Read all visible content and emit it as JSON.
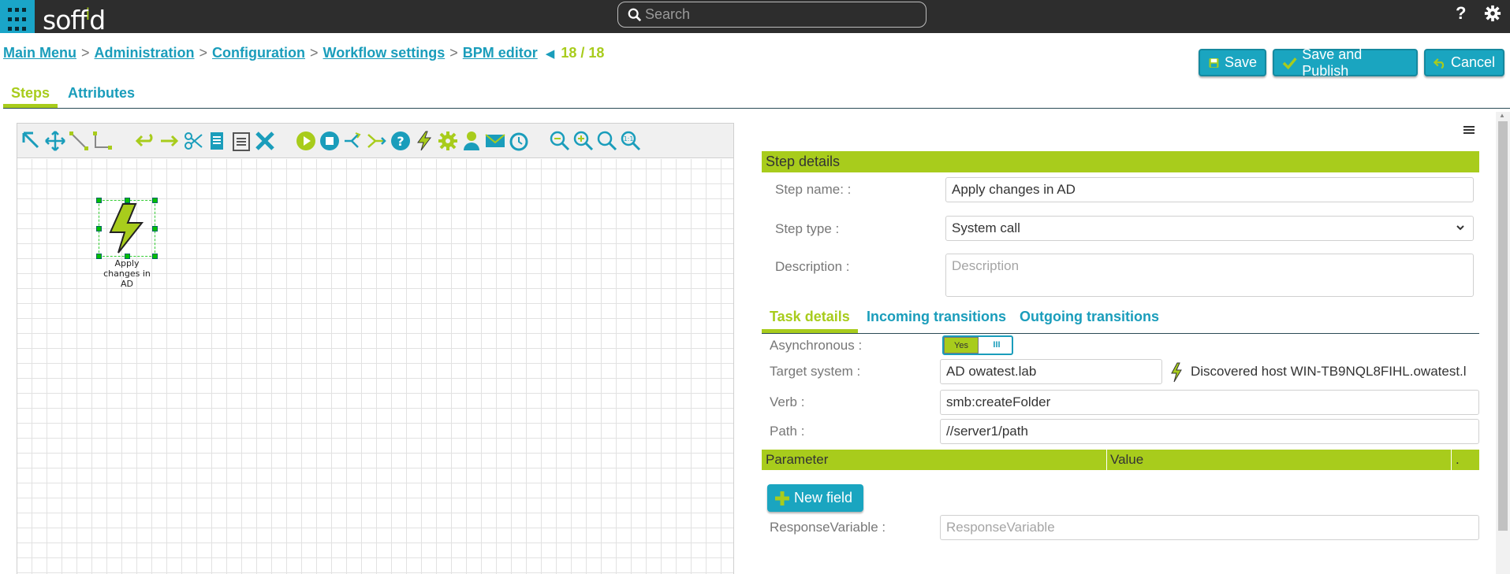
{
  "topbar": {
    "logo_text": "soffid",
    "search_placeholder": "Search",
    "help_label": "?"
  },
  "breadcrumb": {
    "items": [
      "Main Menu",
      "Administration",
      "Configuration",
      "Workflow settings",
      "BPM editor"
    ],
    "separator": ">",
    "counter": "18 / 18"
  },
  "actions": {
    "save": "Save",
    "save_publish": "Save and Publish",
    "cancel": "Cancel"
  },
  "main_tabs": [
    "Steps",
    "Attributes"
  ],
  "diagram": {
    "toolbar_icons": [
      "select-icon",
      "move-icon",
      "connect-icon",
      "orthogonal-connect-icon",
      "undo-icon",
      "redo-icon",
      "cut-icon",
      "copy-icon",
      "paste-icon",
      "delete-icon",
      "start-icon",
      "end-icon",
      "fork-icon",
      "join-icon",
      "decision-icon",
      "system-call-icon",
      "custom-action-icon",
      "user-task-icon",
      "mail-icon",
      "timer-icon",
      "zoom-out-icon",
      "zoom-in-icon",
      "zoom-fit-icon",
      "zoom-actual-icon"
    ],
    "node_label": "Apply changes in AD"
  },
  "step_details": {
    "header": "Step details",
    "name_label": "Step name: :",
    "name_value": "Apply changes in AD",
    "type_label": "Step type :",
    "type_value": "System call",
    "description_label": "Description :",
    "description_placeholder": "Description"
  },
  "sub_tabs": [
    "Task details",
    "Incoming transitions",
    "Outgoing transitions"
  ],
  "task_details": {
    "async_label": "Asynchronous :",
    "async_value": "Yes",
    "async_grip": "III",
    "target_label": "Target system :",
    "target_value": "AD owatest.lab",
    "discovered_text": "Discovered host WIN-TB9NQL8FIHL.owatest.l",
    "verb_label": "Verb :",
    "verb_value": "smb:createFolder",
    "path_label": "Path :",
    "path_value": "//server1/path",
    "param_col": "Parameter",
    "value_col": "Value",
    "extra_col": ".",
    "new_field": "New field",
    "response_label": "ResponseVariable :",
    "response_placeholder": "ResponseVariable"
  },
  "colors": {
    "accent": "#a8cc1c",
    "primary": "#1aa5c0",
    "topbar": "#2d2d2d"
  }
}
